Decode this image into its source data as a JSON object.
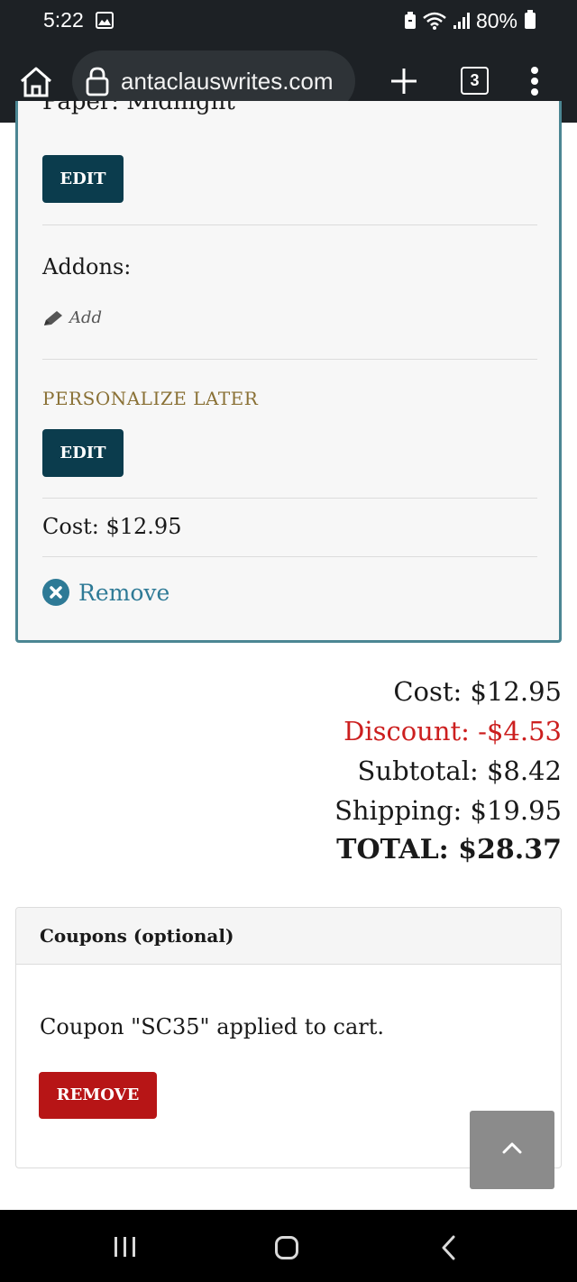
{
  "status_bar": {
    "time": "5:22",
    "battery": "80%"
  },
  "browser": {
    "url": "antaclauswrites.com",
    "tab_count": "3"
  },
  "cart_item": {
    "paper_line": "Paper: Midnight",
    "edit_label": "EDIT",
    "addons_label": "Addons:",
    "add_label": "Add",
    "personalize_label": "PERSONALIZE LATER",
    "cost_line": "Cost: $12.95",
    "remove_label": "Remove"
  },
  "totals": {
    "cost": "Cost: $12.95",
    "discount": "Discount: -$4.53",
    "subtotal": "Subtotal: $8.42",
    "shipping": "Shipping: $19.95",
    "total": "TOTAL: $28.37"
  },
  "coupons": {
    "header": "Coupons (optional)",
    "message": "Coupon \"SC35\" applied to cart.",
    "remove_label": "REMOVE"
  },
  "colors": {
    "accent": "#0b3c4d",
    "discount": "#cc1f1f",
    "remove_button": "#b71516",
    "card_border": "#4b8693"
  }
}
